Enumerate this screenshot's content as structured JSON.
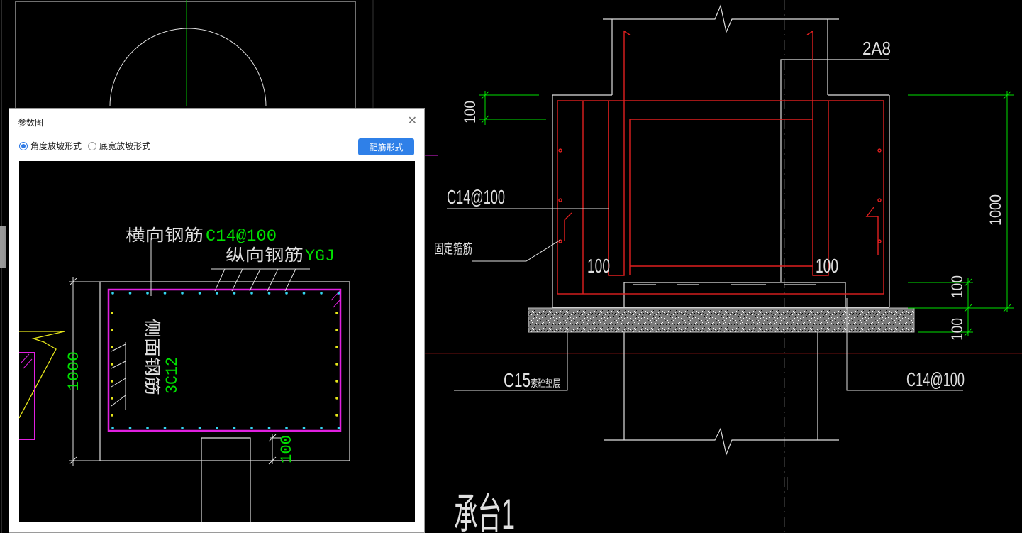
{
  "colors": {
    "canvas_bg": "#000000",
    "accent": "#2f80e8",
    "rebar_red": "#e01f1f",
    "dim_green": "#00e000",
    "magenta": "#e020e0",
    "yellow": "#e6e61a",
    "cyan_dots": "#33d6f0"
  },
  "dialog": {
    "title": "参数图",
    "close_icon": "close-icon",
    "radio_options": [
      {
        "label": "角度放坡形式",
        "checked": true
      },
      {
        "label": "底宽放坡形式",
        "checked": false
      }
    ],
    "rebar_button": "配筋形式",
    "preview": {
      "transverse_label": "横向钢筋",
      "transverse_value": "C14@100",
      "longitudinal_label": "纵向钢筋",
      "longitudinal_value": "YGJ",
      "side_label": "侧面钢筋",
      "side_value": "3C12",
      "height_dim": "1000",
      "bottom_dim": "100"
    }
  },
  "drawing": {
    "top_rebar": "2A8",
    "dim_top_100": "100",
    "left_rebar": "C14@100",
    "fix_bar": "固定箍筋",
    "inner_dim_left": "100",
    "inner_dim_right": "100",
    "height_dim": "1000",
    "dim_bottom_1": "100",
    "dim_bottom_2": "100",
    "bedding_label": "C15",
    "bedding_suffix": "素砼垫层",
    "bottom_rebar": "C14@100",
    "title": "承台1"
  }
}
